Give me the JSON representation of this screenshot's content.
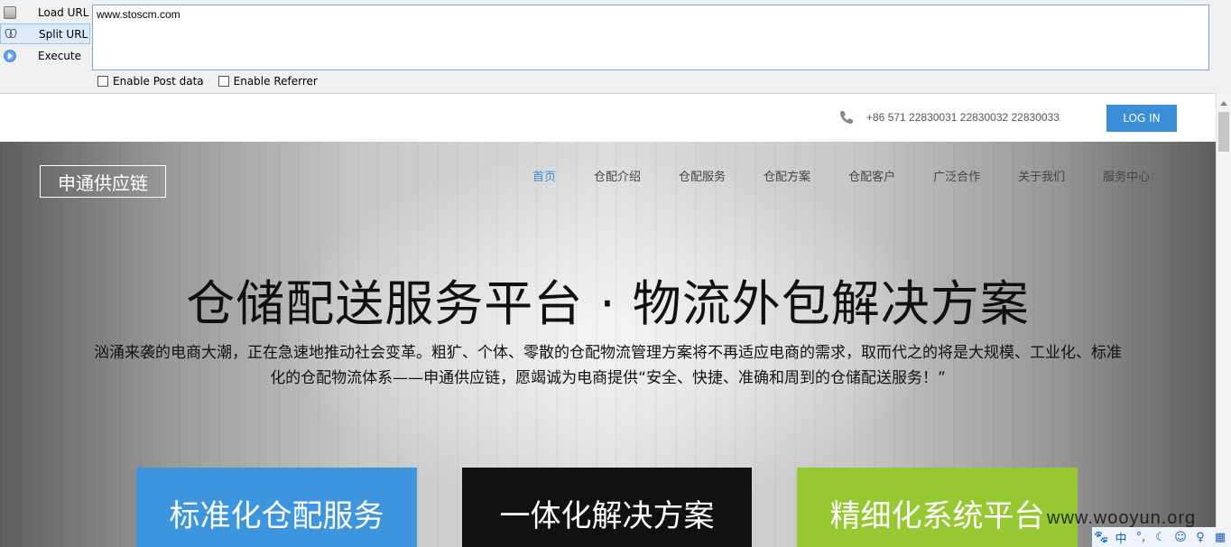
{
  "toolbar": {
    "load_url": "Load URL",
    "split_url": "Split URL",
    "execute": "Execute",
    "url_value": "www.stoscm.com",
    "minus": "-",
    "plus": "+",
    "enable_post": "Enable Post data",
    "enable_referrer": "Enable Referrer"
  },
  "site": {
    "phone": "+86 571 22830031 22830032 22830033",
    "login": "LOG IN",
    "logo": "申通供应链",
    "nav": [
      "首页",
      "仓配介绍",
      "仓配服务",
      "仓配方案",
      "仓配客户",
      "广泛合作",
      "关于我们",
      "服务中心"
    ],
    "headline": "仓储配送服务平台 · 物流外包解决方案",
    "subtext": "汹涌来袭的电商大潮，正在急速地推动社会变革。粗犷、个体、零散的仓配物流管理方案将不再适应电商的需求，取而代之的将是大规模、工业化、标准化的仓配物流体系——申通供应链，愿竭诚为电商提供“安全、快捷、准确和周到的仓储配送服务！”",
    "cards": [
      "标准化仓配服务",
      "一体化解决方案",
      "精细化系统平台"
    ]
  },
  "overlay": {
    "watermark": "www.wooyun.org",
    "tray": [
      "中",
      "°,",
      "☾",
      "☺",
      "♀",
      "▦"
    ]
  },
  "colors": {
    "accent": "#3a8fd8",
    "card_blue": "#3d95de",
    "card_black": "#111111",
    "card_green": "#96c832"
  }
}
